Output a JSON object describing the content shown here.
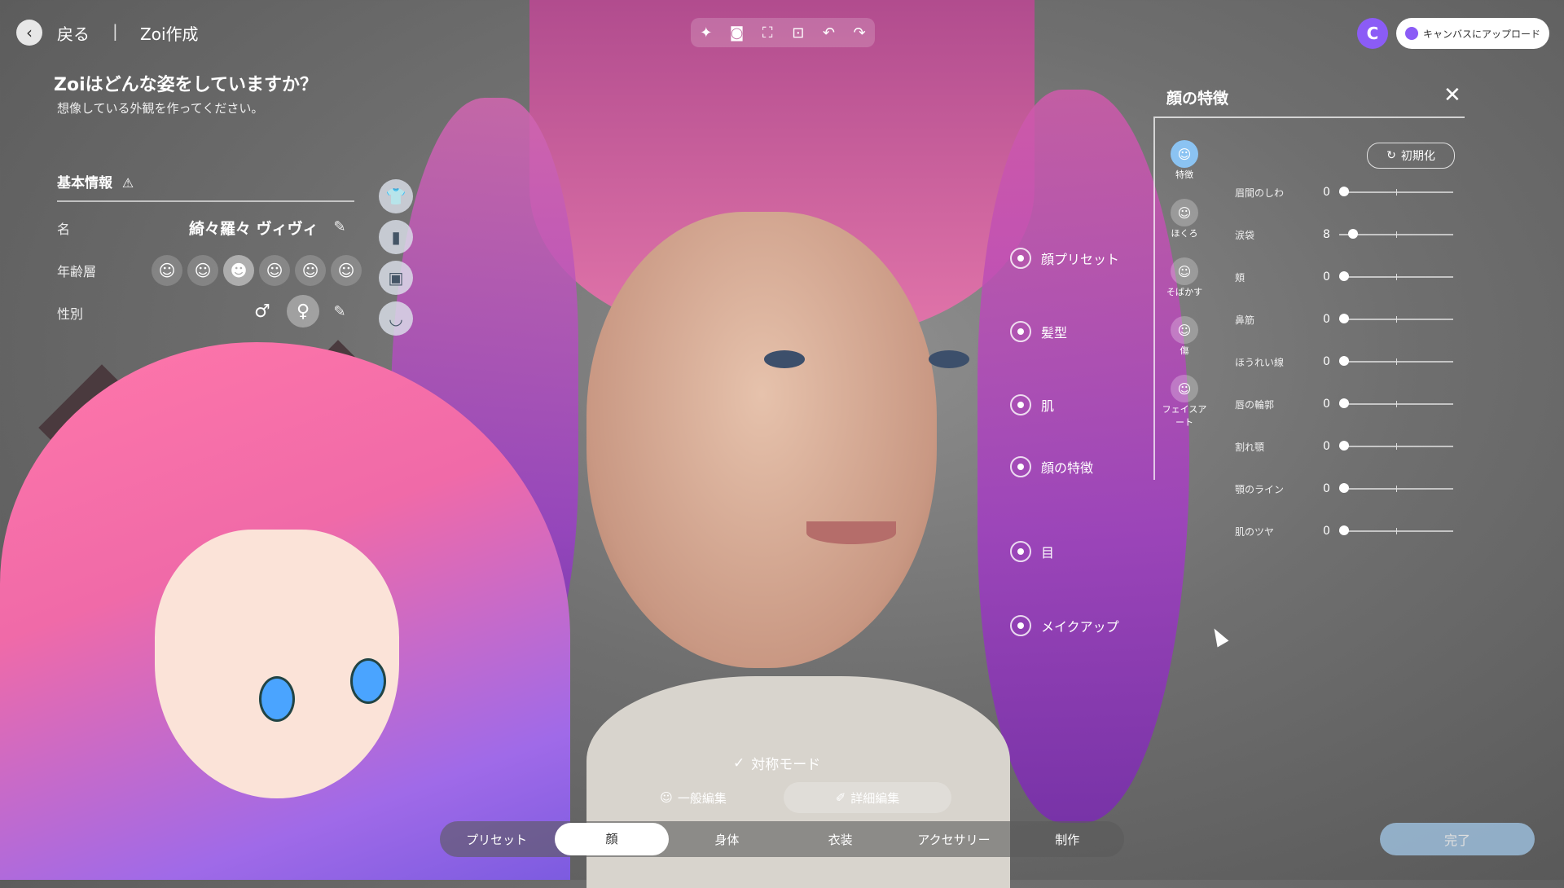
{
  "header": {
    "back_label": "戻る",
    "separator": "|",
    "page_title": "Zoi作成",
    "toolbar_icons": [
      "sparkle-icon",
      "camera-icon",
      "frame-icon",
      "focus-icon",
      "undo-icon",
      "redo-icon"
    ],
    "avatar_letter": "C",
    "upload_label": "キャンバスにアップロード"
  },
  "intro": {
    "question": "Zoiはどんな姿をしていますか？",
    "subtitle": "想像している外観を作ってください。"
  },
  "basic_info": {
    "section_title": "基本情報",
    "name_label": "名",
    "name_value": "綺々羅々 ヴィヴィ",
    "age_label": "年齢層",
    "age_options": [
      "baby",
      "child",
      "teen",
      "adult",
      "middle",
      "elder"
    ],
    "age_selected_index": 2,
    "gender_label": "性別",
    "gender_selected": "female"
  },
  "face_menu": {
    "items": [
      "顔プリセット",
      "髪型",
      "肌",
      "顔の特徴",
      "目",
      "メイクアップ"
    ]
  },
  "feature_panel": {
    "title": "顔の特徴",
    "reset_label": "初期化",
    "categories": [
      {
        "label": "特徴",
        "selected": true
      },
      {
        "label": "ほくろ",
        "selected": false
      },
      {
        "label": "そばかす",
        "selected": false
      },
      {
        "label": "傷",
        "selected": false
      },
      {
        "label": "フェイスアート",
        "selected": false
      }
    ],
    "sliders": [
      {
        "label": "眉間のしわ",
        "value": 0
      },
      {
        "label": "涙袋",
        "value": 8
      },
      {
        "label": "頬",
        "value": 0
      },
      {
        "label": "鼻筋",
        "value": 0
      },
      {
        "label": "ほうれい線",
        "value": 0
      },
      {
        "label": "唇の輪郭",
        "value": 0
      },
      {
        "label": "割れ顎",
        "value": 0
      },
      {
        "label": "顎のライン",
        "value": 0
      },
      {
        "label": "肌のツヤ",
        "value": 0
      }
    ]
  },
  "bottom": {
    "symmetry_label": "対称モード",
    "general_edit": "一般編集",
    "detail_edit": "詳細編集",
    "tabs": [
      "プリセット",
      "顔",
      "身体",
      "衣装",
      "アクセサリー",
      "制作"
    ],
    "selected_tab": 1,
    "done_label": "完了"
  },
  "colors": {
    "accent": "#8b5cf6",
    "selected_category": "#8bc3f2",
    "done_button": "#9fc3e2"
  }
}
